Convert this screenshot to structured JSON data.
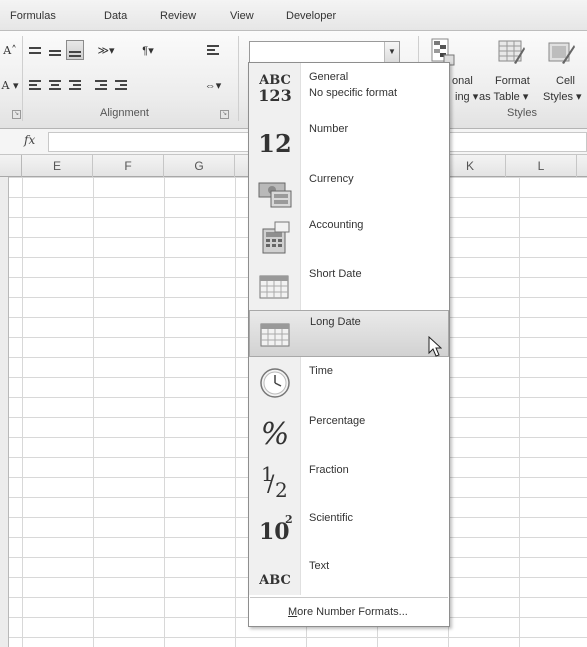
{
  "tabs": [
    "Formulas",
    "Data",
    "Review",
    "View",
    "Developer"
  ],
  "ribbon": {
    "alignment_group_label": "Alignment",
    "styles_group_label": "Styles",
    "font_grow_glyph": "A˄",
    "font_color_glyph": "A ▾",
    "conditional_label_1": "onal",
    "conditional_label_2": "ing ▾",
    "format_table_label_1": "Format",
    "format_table_label_2": "as Table ▾",
    "cell_styles_label_1": "Cell",
    "cell_styles_label_2": "Styles ▾",
    "number_format_value": ""
  },
  "formula_bar": {
    "fx_label": "fx",
    "value": ""
  },
  "columns": [
    "E",
    "F",
    "G",
    "K",
    "L"
  ],
  "number_format_menu": {
    "items": [
      {
        "label": "General",
        "sublabel": "No specific format",
        "icon": "abc-123-icon",
        "icon_text_1": "ABC",
        "icon_text_2": "123"
      },
      {
        "label": "Number",
        "sublabel": "",
        "icon": "number-icon",
        "icon_text_1": "12"
      },
      {
        "label": "Currency",
        "sublabel": "",
        "icon": "currency-icon"
      },
      {
        "label": "Accounting",
        "sublabel": "",
        "icon": "accounting-icon"
      },
      {
        "label": "Short Date",
        "sublabel": "",
        "icon": "calendar-icon"
      },
      {
        "label": "Long Date",
        "sublabel": "",
        "icon": "calendar-icon",
        "highlighted": true
      },
      {
        "label": "Time",
        "sublabel": "",
        "icon": "clock-icon"
      },
      {
        "label": "Percentage",
        "sublabel": "",
        "icon": "percent-icon",
        "icon_text_1": "%"
      },
      {
        "label": "Fraction",
        "sublabel": "",
        "icon": "fraction-icon",
        "icon_text_1": "1",
        "icon_text_2": "2"
      },
      {
        "label": "Scientific",
        "sublabel": "",
        "icon": "scientific-icon",
        "icon_text_1": "10",
        "icon_text_2": "2"
      },
      {
        "label": "Text",
        "sublabel": "",
        "icon": "abc-icon",
        "icon_text_1": "ABC"
      }
    ],
    "more_label": "More Number Formats..."
  },
  "colors": {
    "highlight": "#d9d9d9",
    "menu_border": "#8e8e8e"
  }
}
